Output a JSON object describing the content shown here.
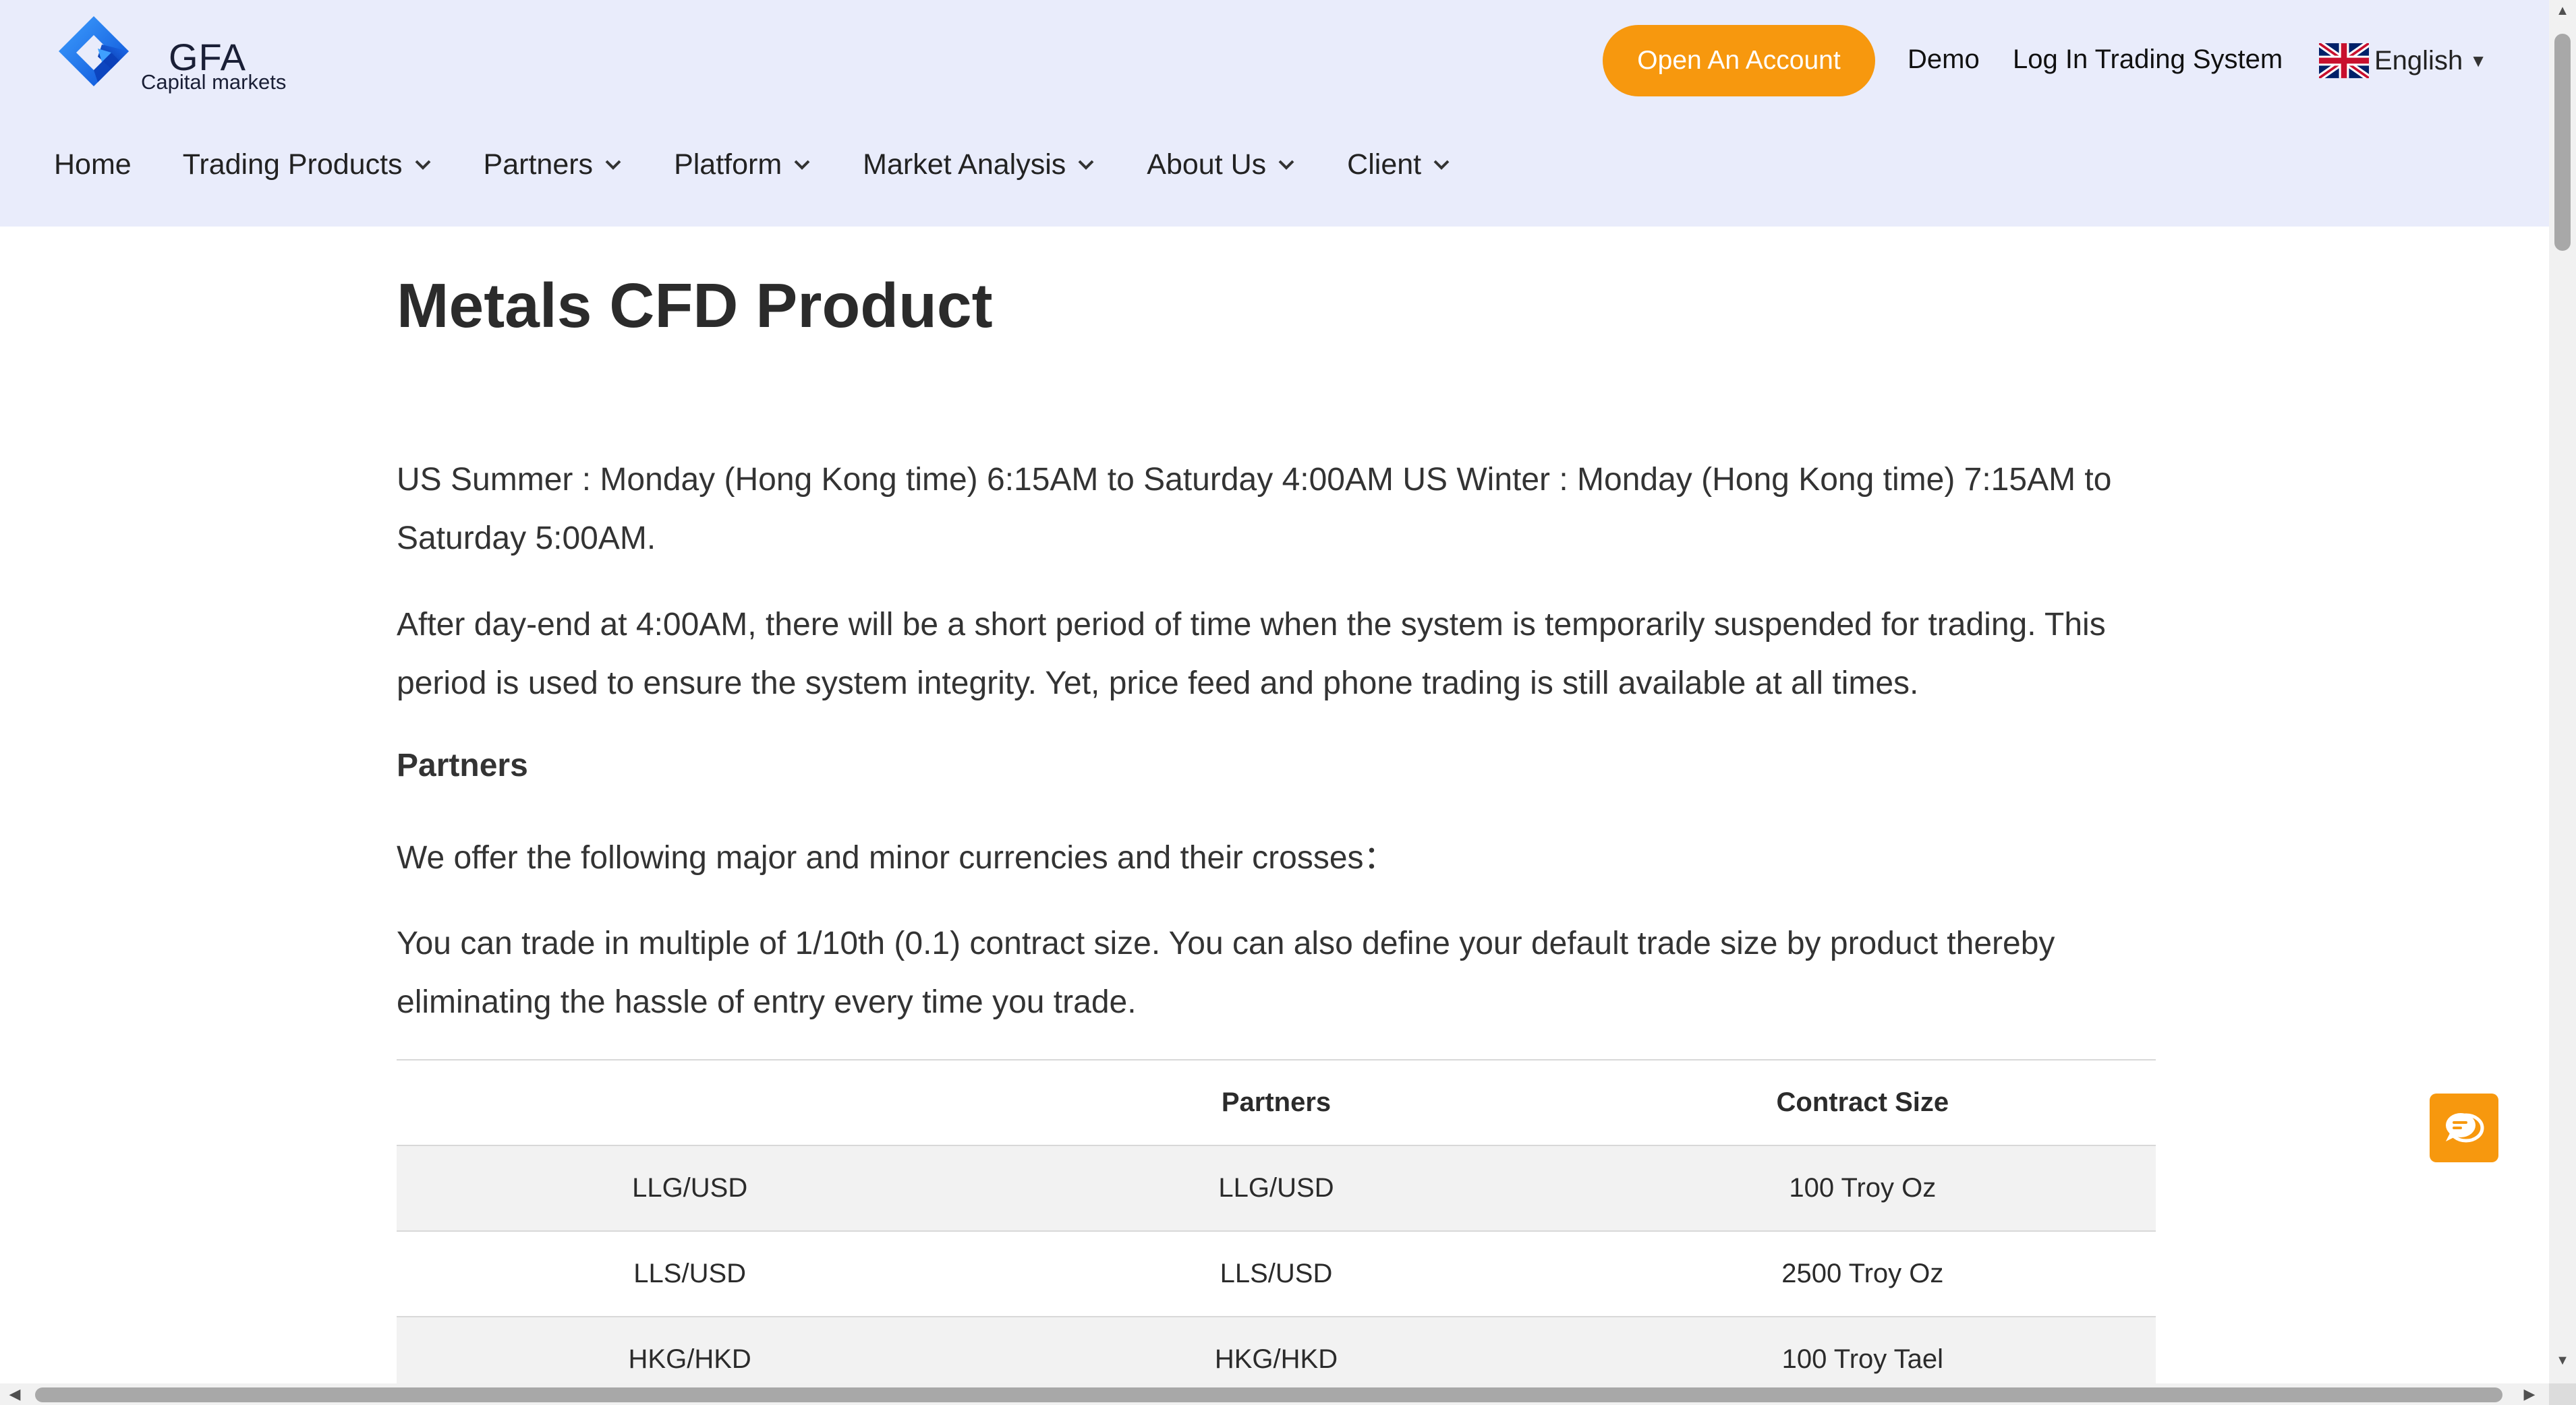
{
  "brand": {
    "name": "GFA",
    "tagline": "Capital markets",
    "logo_icon": "gfa-diamond-logo",
    "accent_color": "#f7980e",
    "header_bg": "#e9ecfb"
  },
  "header": {
    "open_account_label": "Open An Account",
    "demo_label": "Demo",
    "login_label": "Log In Trading System",
    "language": {
      "label": "English",
      "flag_icon": "uk-flag-icon",
      "caret_icon": "caret-down-icon",
      "caret_glyph": "▼"
    }
  },
  "nav": {
    "items": [
      {
        "label": "Home",
        "has_dropdown": false
      },
      {
        "label": "Trading Products",
        "has_dropdown": true
      },
      {
        "label": "Partners",
        "has_dropdown": true
      },
      {
        "label": "Platform",
        "has_dropdown": true
      },
      {
        "label": "Market Analysis",
        "has_dropdown": true
      },
      {
        "label": "About Us",
        "has_dropdown": true
      },
      {
        "label": "Client",
        "has_dropdown": true
      }
    ]
  },
  "main": {
    "title": "Metals CFD Product",
    "trading_hours": "US Summer : Monday (Hong Kong time) 6:15AM to Saturday 4:00AM US Winter : Monday (Hong Kong time) 7:15AM to Saturday 5:00AM.",
    "day_end_note": "After day-end at 4:00AM, there will be a short period of time when the system is temporarily suspended for trading. This period is used to ensure the system integrity. Yet, price feed and phone trading is still available at all times.",
    "partners_heading": "Partners",
    "offer_text": "We offer the following major and minor currencies and their crosses：",
    "contract_text": "You can trade in multiple of 1/10th (0.1) contract size. You can also define your default trade size by product thereby eliminating the hassle of entry every time you trade.",
    "table": {
      "headers": [
        "",
        "Partners",
        "Contract Size"
      ],
      "rows": [
        [
          "LLG/USD",
          "LLG/USD",
          "100 Troy Oz"
        ],
        [
          "LLS/USD",
          "LLS/USD",
          "2500 Troy Oz"
        ],
        [
          "HKG/HKD",
          "HKG/HKD",
          "100 Troy Tael"
        ]
      ]
    }
  },
  "chat": {
    "icon": "chat-bubble-icon"
  },
  "scrollbars": {
    "up_glyph": "▲",
    "down_glyph": "▼",
    "left_glyph": "◀",
    "right_glyph": "▶"
  }
}
